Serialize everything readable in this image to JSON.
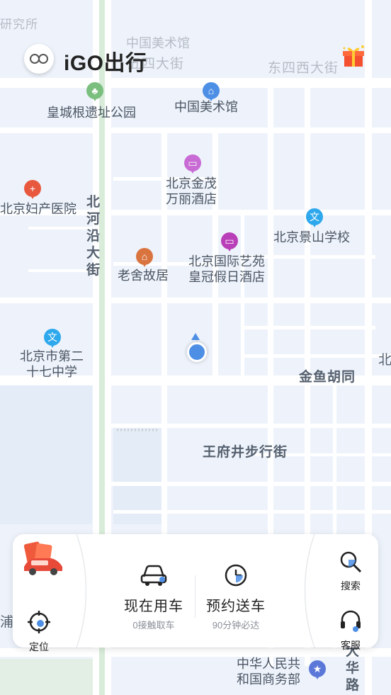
{
  "app": {
    "name": "iGO出行"
  },
  "map": {
    "pois": [
      {
        "label": "中国美术馆",
        "icon": "museum-icon"
      },
      {
        "label": "皇城根遗址公园",
        "icon": "park-icon"
      },
      {
        "label": "北京金茂\n万丽酒店",
        "icon": "hotel-icon"
      },
      {
        "label": "北京妇产医院",
        "icon": "hospital-icon"
      },
      {
        "label": "北京景山学校",
        "icon": "school-icon"
      },
      {
        "label": "老舍故居",
        "icon": "landmark-icon"
      },
      {
        "label": "北京国际艺苑\n皇冠假日酒店",
        "icon": "hotel-icon"
      },
      {
        "label": "北京市第二\n十七中学",
        "icon": "school-icon"
      },
      {
        "label": "中华人民共\n和国商务部",
        "icon": "government-icon"
      }
    ],
    "streets": {
      "top_left": "中国美术馆",
      "wusi": "五四大街",
      "dongsixi": "东四西大街",
      "beiheyan": "北河沿大街",
      "jinyu": "金鱼胡同",
      "wangfujing": "王府井步行街",
      "partial_right": "北",
      "dahualu": "大华路",
      "partial_left": "浦",
      "top_faded": "研究所"
    }
  },
  "panel": {
    "promo_icon": "red-car-envelope-icon",
    "locate_label": "定位",
    "search_label": "搜索",
    "service_label": "客服",
    "ride_now": {
      "title": "现在用车",
      "subtitle": "0接触取车",
      "icon": "car-icon"
    },
    "schedule": {
      "title": "预约送车",
      "subtitle": "90分钟必达",
      "icon": "clock-icon"
    }
  },
  "colors": {
    "accent_blue": "#4e8fe6",
    "road": "#ffffff",
    "park_green": "#d8ecd9",
    "water": "#d2e4f6"
  }
}
